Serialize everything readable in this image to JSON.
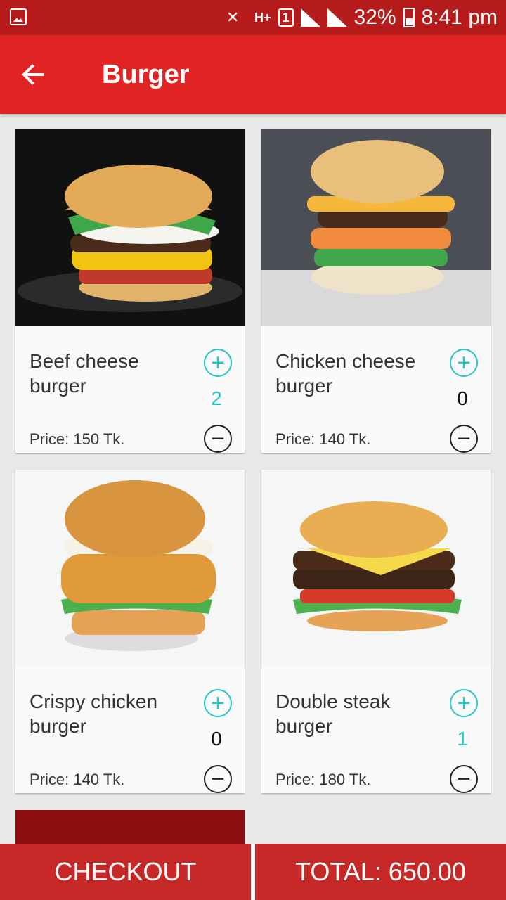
{
  "status_bar": {
    "battery": "32%",
    "time": "8:41 pm",
    "sim": "1",
    "network": "H+"
  },
  "toolbar": {
    "title": "Burger",
    "back_icon": "arrow-back-icon"
  },
  "items": [
    {
      "name": "Beef cheese burger",
      "price": "Price: 150 Tk.",
      "qty": "2",
      "qty_color": "#26c6c6"
    },
    {
      "name": "Chicken cheese burger",
      "price": "Price: 140 Tk.",
      "qty": "0",
      "qty_color": "#111111"
    },
    {
      "name": "Crispy chicken burger",
      "price": "Price: 140 Tk.",
      "qty": "0",
      "qty_color": "#111111"
    },
    {
      "name": "Double steak burger",
      "price": "Price: 180 Tk.",
      "qty": "1",
      "qty_color": "#26c6c6"
    }
  ],
  "buttons": {
    "plus": "+",
    "minus": "−"
  },
  "footer": {
    "checkout": "CHECKOUT",
    "total": "TOTAL: 650.00"
  },
  "colors": {
    "toolbar": "#e02424",
    "status": "#b71c1c",
    "accent": "#26c6c6",
    "footer": "#c62828"
  }
}
